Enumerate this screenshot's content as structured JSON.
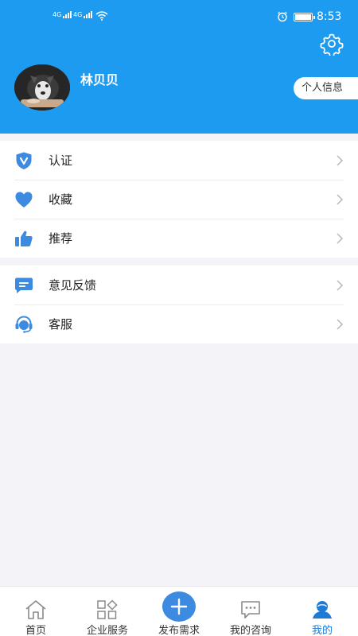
{
  "status_bar": {
    "sim1": "4G",
    "sim2": "4G",
    "time": "8:53",
    "battery_level": 0.9
  },
  "profile": {
    "username": "林贝贝",
    "info_button": "个人信息"
  },
  "menu_group1": [
    {
      "label": "认证",
      "icon": "shield-v-icon"
    },
    {
      "label": "收藏",
      "icon": "heart-icon"
    },
    {
      "label": "推荐",
      "icon": "thumbs-up-icon"
    }
  ],
  "menu_group2": [
    {
      "label": "意见反馈",
      "icon": "chat-icon"
    },
    {
      "label": "客服",
      "icon": "headset-icon"
    }
  ],
  "tabbar": [
    {
      "label": "首页",
      "icon": "home-icon",
      "active": false
    },
    {
      "label": "企业服务",
      "icon": "grid-icon",
      "active": false
    },
    {
      "label": "发布需求",
      "icon": "plus-icon",
      "active": false
    },
    {
      "label": "我的咨询",
      "icon": "message-icon",
      "active": false
    },
    {
      "label": "我的",
      "icon": "user-icon",
      "active": true
    }
  ],
  "colors": {
    "header_blue": "#1d9bf0",
    "icon_blue": "#3d8be0",
    "active_tab": "#1d7bd6",
    "background": "#f4f4f8"
  }
}
